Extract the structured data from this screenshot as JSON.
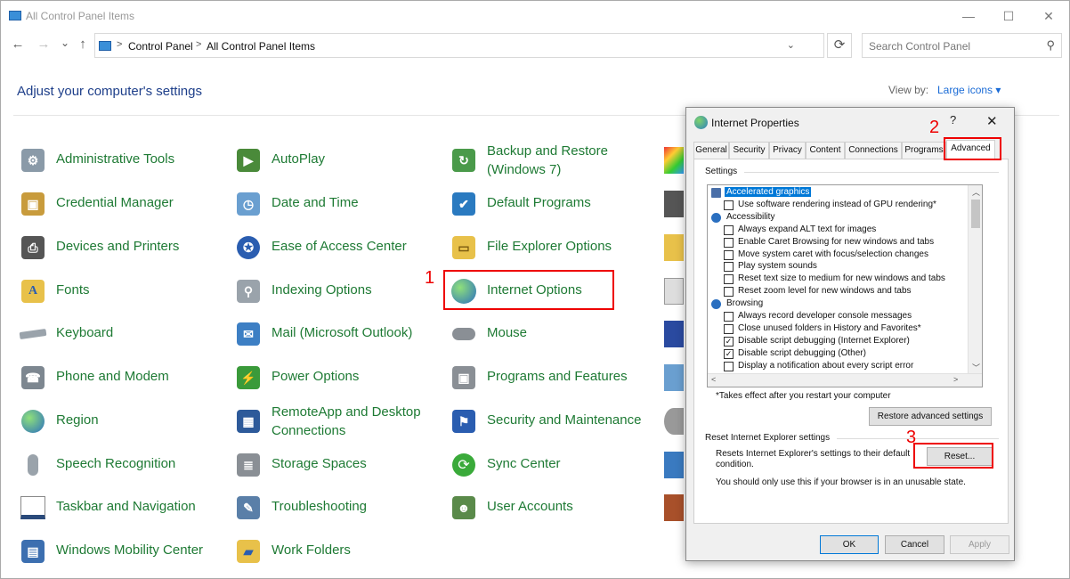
{
  "window": {
    "title": "All Control Panel Items",
    "minimize": "—",
    "maximize": "☐",
    "close": "✕"
  },
  "address": {
    "back": "←",
    "forward": "→",
    "history": "⌄",
    "up": "↑",
    "breadcrumbs": [
      "Control Panel",
      "All Control Panel Items"
    ],
    "separator": ">",
    "dropdown": "⌄",
    "refresh": "⟳",
    "search_placeholder": "Search Control Panel",
    "search_icon": "⚲"
  },
  "main": {
    "heading": "Adjust your computer's settings",
    "view_by_label": "View by:",
    "view_by_value": "Large icons ▾"
  },
  "columns": [
    [
      {
        "label": "Administrative Tools",
        "icon": "admin-tools-icon"
      },
      {
        "label": "Credential Manager",
        "icon": "credential-icon"
      },
      {
        "label": "Devices and Printers",
        "icon": "printer-icon"
      },
      {
        "label": "Fonts",
        "icon": "fonts-icon"
      },
      {
        "label": "Keyboard",
        "icon": "keyboard-icon"
      },
      {
        "label": "Phone and Modem",
        "icon": "phone-icon"
      },
      {
        "label": "Region",
        "icon": "globe-icon"
      },
      {
        "label": "Speech Recognition",
        "icon": "microphone-icon"
      },
      {
        "label": "Taskbar and Navigation",
        "icon": "taskbar-icon"
      },
      {
        "label": "Windows Mobility Center",
        "icon": "mobility-icon"
      }
    ],
    [
      {
        "label": "AutoPlay",
        "icon": "autoplay-icon"
      },
      {
        "label": "Date and Time",
        "icon": "clock-icon"
      },
      {
        "label": "Ease of Access Center",
        "icon": "accessibility-icon"
      },
      {
        "label": "Indexing Options",
        "icon": "indexing-icon"
      },
      {
        "label": "Mail (Microsoft Outlook)",
        "icon": "mail-icon"
      },
      {
        "label": "Power Options",
        "icon": "power-icon"
      },
      {
        "label": "RemoteApp and Desktop Connections",
        "icon": "remoteapp-icon"
      },
      {
        "label": "Storage Spaces",
        "icon": "storage-icon"
      },
      {
        "label": "Troubleshooting",
        "icon": "troubleshoot-icon"
      },
      {
        "label": "Work Folders",
        "icon": "work-folders-icon"
      }
    ],
    [
      {
        "label": "Backup and Restore (Windows 7)",
        "icon": "backup-icon"
      },
      {
        "label": "Default Programs",
        "icon": "default-programs-icon"
      },
      {
        "label": "File Explorer Options",
        "icon": "folder-options-icon"
      },
      {
        "label": "Internet Options",
        "icon": "internet-options-icon"
      },
      {
        "label": "Mouse",
        "icon": "mouse-icon"
      },
      {
        "label": "Programs and Features",
        "icon": "programs-icon"
      },
      {
        "label": "Security and Maintenance",
        "icon": "flag-icon"
      },
      {
        "label": "Sync Center",
        "icon": "sync-icon"
      },
      {
        "label": "User Accounts",
        "icon": "users-icon"
      }
    ]
  ],
  "annotations": {
    "step1": "1",
    "step2": "2",
    "step3": "3",
    "color": "#e00000"
  },
  "dialog": {
    "title": "Internet Properties",
    "help": "?",
    "close": "✕",
    "tabs": [
      "General",
      "Security",
      "Privacy",
      "Content",
      "Connections",
      "Programs",
      "Advanced"
    ],
    "active_tab": "Advanced",
    "settings_label": "Settings",
    "list": [
      {
        "type": "category",
        "text": "Accelerated graphics",
        "selected": true
      },
      {
        "type": "check",
        "text": "Use software rendering instead of GPU rendering*",
        "checked": false
      },
      {
        "type": "category",
        "text": "Accessibility",
        "selected": false
      },
      {
        "type": "check",
        "text": "Always expand ALT text for images",
        "checked": false
      },
      {
        "type": "check",
        "text": "Enable Caret Browsing for new windows and tabs",
        "checked": false
      },
      {
        "type": "check",
        "text": "Move system caret with focus/selection changes",
        "checked": false
      },
      {
        "type": "check",
        "text": "Play system sounds",
        "checked": false
      },
      {
        "type": "check",
        "text": "Reset text size to medium for new windows and tabs",
        "checked": false
      },
      {
        "type": "check",
        "text": "Reset zoom level for new windows and tabs",
        "checked": false
      },
      {
        "type": "category",
        "text": "Browsing",
        "selected": false
      },
      {
        "type": "check",
        "text": "Always record developer console messages",
        "checked": false
      },
      {
        "type": "check",
        "text": "Close unused folders in History and Favorites*",
        "checked": false
      },
      {
        "type": "check",
        "text": "Disable script debugging (Internet Explorer)",
        "checked": true
      },
      {
        "type": "check",
        "text": "Disable script debugging (Other)",
        "checked": true
      },
      {
        "type": "check",
        "text": "Display a notification about every script error",
        "checked": false
      }
    ],
    "takes_effect_note": "*Takes effect after you restart your computer",
    "restore_button": "Restore advanced settings",
    "reset_group_label": "Reset Internet Explorer settings",
    "reset_description": "Resets Internet Explorer's settings to their default condition.",
    "reset_button": "Reset...",
    "unusable_note": "You should only use this if your browser is in an unusable state.",
    "ok": "OK",
    "cancel": "Cancel",
    "apply": "Apply"
  }
}
